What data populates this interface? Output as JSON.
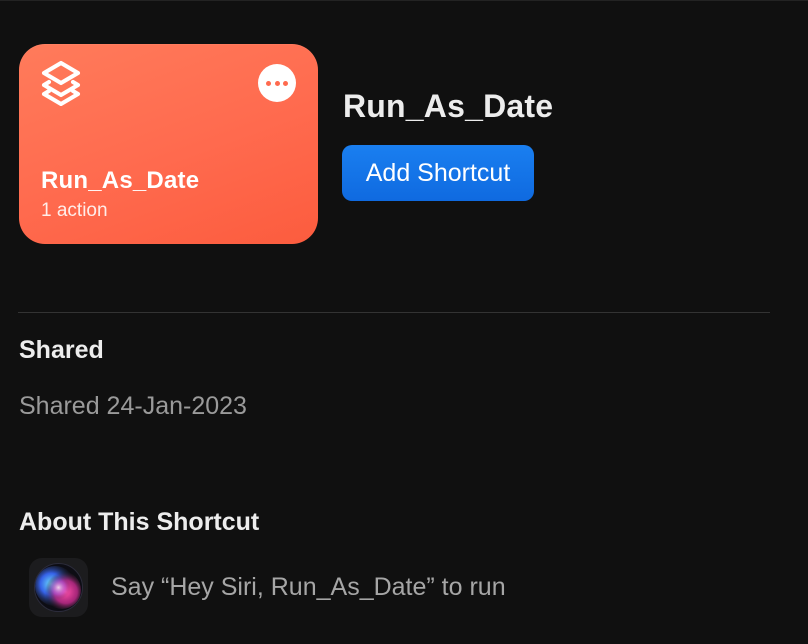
{
  "shortcut": {
    "name": "Run_As_Date",
    "action_count": "1 action",
    "card_color": "#ff6a4e",
    "icon": "shortcuts-layers-icon",
    "more_icon": "more-ellipsis-icon"
  },
  "header": {
    "title": "Run_As_Date",
    "add_button_label": "Add Shortcut",
    "accent_color": "#0f6ae0"
  },
  "shared": {
    "heading": "Shared",
    "date_text": "Shared 24-Jan-2023"
  },
  "about": {
    "heading": "About This Shortcut",
    "siri_icon": "siri-icon",
    "siri_text": "Say “Hey Siri, Run_As_Date” to run"
  }
}
